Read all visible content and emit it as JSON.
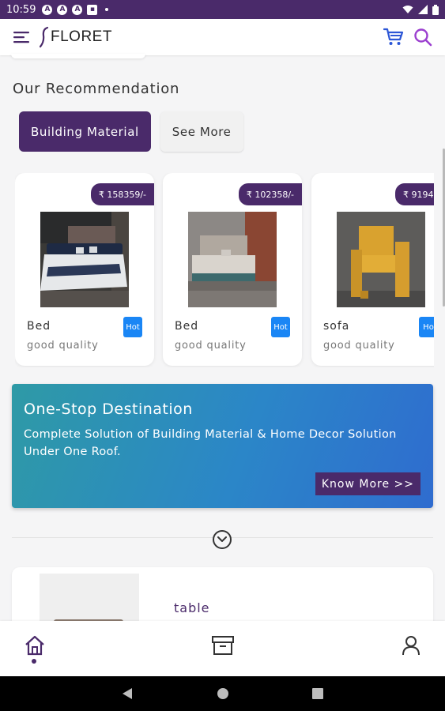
{
  "status_bar": {
    "time": "10:59",
    "icons": [
      "a-icon",
      "a-icon",
      "a-icon",
      "calendar-icon",
      "dot"
    ],
    "right_icons": [
      "wifi-icon",
      "signal-icon",
      "battery-icon"
    ]
  },
  "app_bar": {
    "logo_text": "FLORET",
    "menu_icon": "hamburger-menu-icon",
    "cart_icon": "cart-icon",
    "search_icon": "search-icon"
  },
  "recommendation": {
    "title": "Our Recommendation",
    "chips": [
      {
        "label": "Building Material",
        "active": true
      },
      {
        "label": "See More",
        "active": false
      }
    ]
  },
  "products": [
    {
      "price": "₹ 158359/-",
      "name": "Bed",
      "badge": "Hot",
      "desc": "good quality"
    },
    {
      "price": "₹ 102358/-",
      "name": "Bed",
      "badge": "Hot",
      "desc": "good quality"
    },
    {
      "price": "₹ 9194",
      "name": "sofa",
      "badge": "Ho",
      "desc": "good quality"
    }
  ],
  "banner": {
    "title": "One-Stop Destination",
    "text": "Complete Solution of Building Material & Home Decor Solution Under One Roof.",
    "button": "Know More >>"
  },
  "list": {
    "items": [
      {
        "title": "table"
      }
    ]
  },
  "bottom_nav": {
    "items": [
      "home-icon",
      "archive-icon",
      "profile-icon"
    ],
    "active": "home-icon"
  },
  "colors": {
    "primary": "#4a2a6a",
    "accent_blue": "#1a86f5",
    "banner_gradient_start": "#2e9aa6",
    "banner_gradient_end": "#2f6ccf"
  }
}
